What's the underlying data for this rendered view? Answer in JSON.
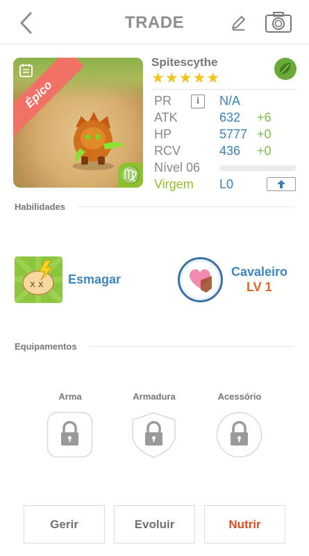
{
  "header": {
    "title": "TRADE",
    "back_icon": "chevron-left-icon",
    "edit_icon": "pencil-icon",
    "camera_icon": "camera-icon"
  },
  "monster": {
    "name": "Spitescythe",
    "rarity": "Épico",
    "stars": 5,
    "element_icon": "leaf-icon",
    "zodiac_symbol": "♍",
    "stats": {
      "pr": {
        "label": "PR",
        "value": "N/A"
      },
      "atk": {
        "label": "ATK",
        "value": "632",
        "bonus": "+6"
      },
      "hp": {
        "label": "HP",
        "value": "5777",
        "bonus": "+0"
      },
      "rcv": {
        "label": "RCV",
        "value": "436",
        "bonus": "+0"
      },
      "level": {
        "label": "Nível 06",
        "progress": 0
      },
      "zodiac": {
        "label": "Virgem",
        "value": "L0"
      }
    }
  },
  "skills": {
    "section_title": "Habilidades",
    "active": {
      "name": "Esmagar"
    },
    "leader": {
      "name": "Cavaleiro",
      "level": "LV 1"
    }
  },
  "equipment": {
    "section_title": "Equipamentos",
    "slots": [
      {
        "label": "Arma"
      },
      {
        "label": "Armadura"
      },
      {
        "label": "Acessório"
      }
    ]
  },
  "actions": {
    "manage": "Gerir",
    "evolve": "Evoluir",
    "feed": "Nutrir"
  },
  "colors": {
    "accent_blue": "#3d86c2",
    "accent_orange": "#e04a1f",
    "bonus_green": "#7cc04b",
    "star_gold": "#f5c218",
    "ribbon_red": "#f27167"
  }
}
